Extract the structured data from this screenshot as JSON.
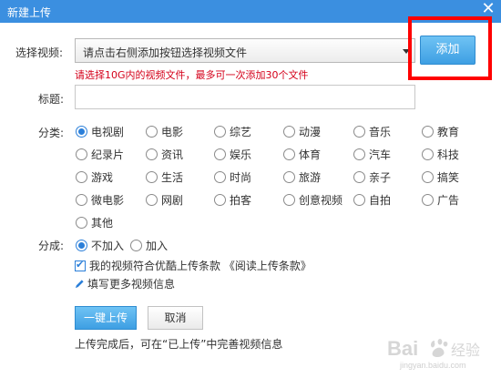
{
  "window": {
    "title": "新建上传",
    "close_glyph": "✕"
  },
  "form": {
    "video_label": "选择视频:",
    "file_placeholder": "请点击右侧添加按钮选择视频文件",
    "add_button": "添加",
    "hint": "请选择10G内的视频文件，最多可一次添加30个文件",
    "title_label": "标题:",
    "title_value": "",
    "category_label": "分类:",
    "categories": [
      {
        "label": "电视剧",
        "selected": true
      },
      {
        "label": "电影",
        "selected": false
      },
      {
        "label": "综艺",
        "selected": false
      },
      {
        "label": "动漫",
        "selected": false
      },
      {
        "label": "音乐",
        "selected": false
      },
      {
        "label": "教育",
        "selected": false
      },
      {
        "label": "纪录片",
        "selected": false
      },
      {
        "label": "资讯",
        "selected": false
      },
      {
        "label": "娱乐",
        "selected": false
      },
      {
        "label": "体育",
        "selected": false
      },
      {
        "label": "汽车",
        "selected": false
      },
      {
        "label": "科技",
        "selected": false
      },
      {
        "label": "游戏",
        "selected": false
      },
      {
        "label": "生活",
        "selected": false
      },
      {
        "label": "时尚",
        "selected": false
      },
      {
        "label": "旅游",
        "selected": false
      },
      {
        "label": "亲子",
        "selected": false
      },
      {
        "label": "搞笑",
        "selected": false
      },
      {
        "label": "微电影",
        "selected": false
      },
      {
        "label": "网剧",
        "selected": false
      },
      {
        "label": "拍客",
        "selected": false
      },
      {
        "label": "创意视频",
        "selected": false
      },
      {
        "label": "自拍",
        "selected": false
      },
      {
        "label": "广告",
        "selected": false
      },
      {
        "label": "其他",
        "selected": false
      }
    ],
    "share_label": "分成:",
    "share_options": [
      {
        "label": "不加入",
        "selected": true
      },
      {
        "label": "加入",
        "selected": false
      }
    ],
    "terms_text": "我的视频符合优酷上传条款 《阅读上传条款》",
    "terms_checked": true,
    "more_info": "填写更多视频信息",
    "upload_button": "一键上传",
    "cancel_button": "取消",
    "footer_note": "上传完成后，可在“已上传”中完善视频信息"
  },
  "watermark": {
    "text_left": "Bai",
    "text_right": "经验",
    "subtext": "jingyan.baidu.com"
  },
  "colors": {
    "titlebar": "#3b8fe0",
    "accent": "#3e9fe3",
    "hint": "#d4001a",
    "highlight_frame": "#ff0000"
  }
}
